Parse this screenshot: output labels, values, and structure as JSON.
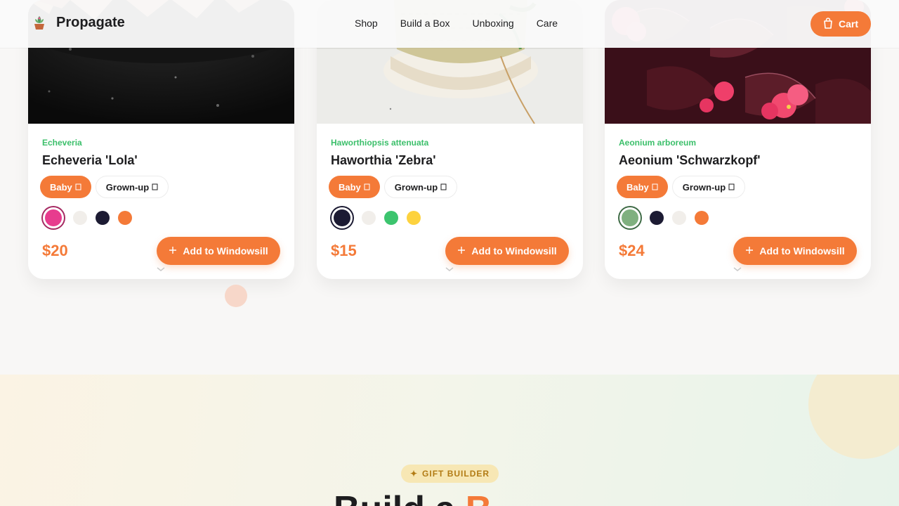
{
  "header": {
    "brand": "Propagate",
    "nav": [
      "Shop",
      "Build a Box",
      "Unboxing",
      "Care"
    ],
    "cart_label": "Cart"
  },
  "cards": [
    {
      "botanical": "Echeveria",
      "title": "Echeveria 'Lola'",
      "sizes": [
        "Baby",
        "Grown-up"
      ],
      "active_size": "Baby",
      "swatches": [
        "#e73c8e",
        "#f1eeea",
        "#1c1b33",
        "#f47a38"
      ],
      "selected_swatch": 0,
      "price": "$20",
      "add_label": "Add to Windowsill"
    },
    {
      "botanical": "Haworthiopsis attenuata",
      "title": "Haworthia 'Zebra'",
      "sizes": [
        "Baby",
        "Grown-up"
      ],
      "active_size": "Baby",
      "swatches": [
        "#1c1b33",
        "#f1eeea",
        "#3cc46e",
        "#fdd23e"
      ],
      "selected_swatch": 0,
      "price": "$15",
      "add_label": "Add to Windowsill"
    },
    {
      "botanical": "Aeonium arboreum",
      "title": "Aeonium 'Schwarzkopf'",
      "sizes": [
        "Baby",
        "Grown-up"
      ],
      "active_size": "Baby",
      "swatches": [
        "#7fb07f",
        "#1c1b33",
        "#f1eeea",
        "#f47a38"
      ],
      "selected_swatch": 0,
      "price": "$24",
      "add_label": "Add to Windowsill"
    }
  ],
  "gift": {
    "badge": "GIFT BUILDER",
    "title_start": "Build a",
    "title_accent": "B"
  },
  "colors": {
    "accent": "#f47a38",
    "botanical_green": "#3bbf6a"
  }
}
